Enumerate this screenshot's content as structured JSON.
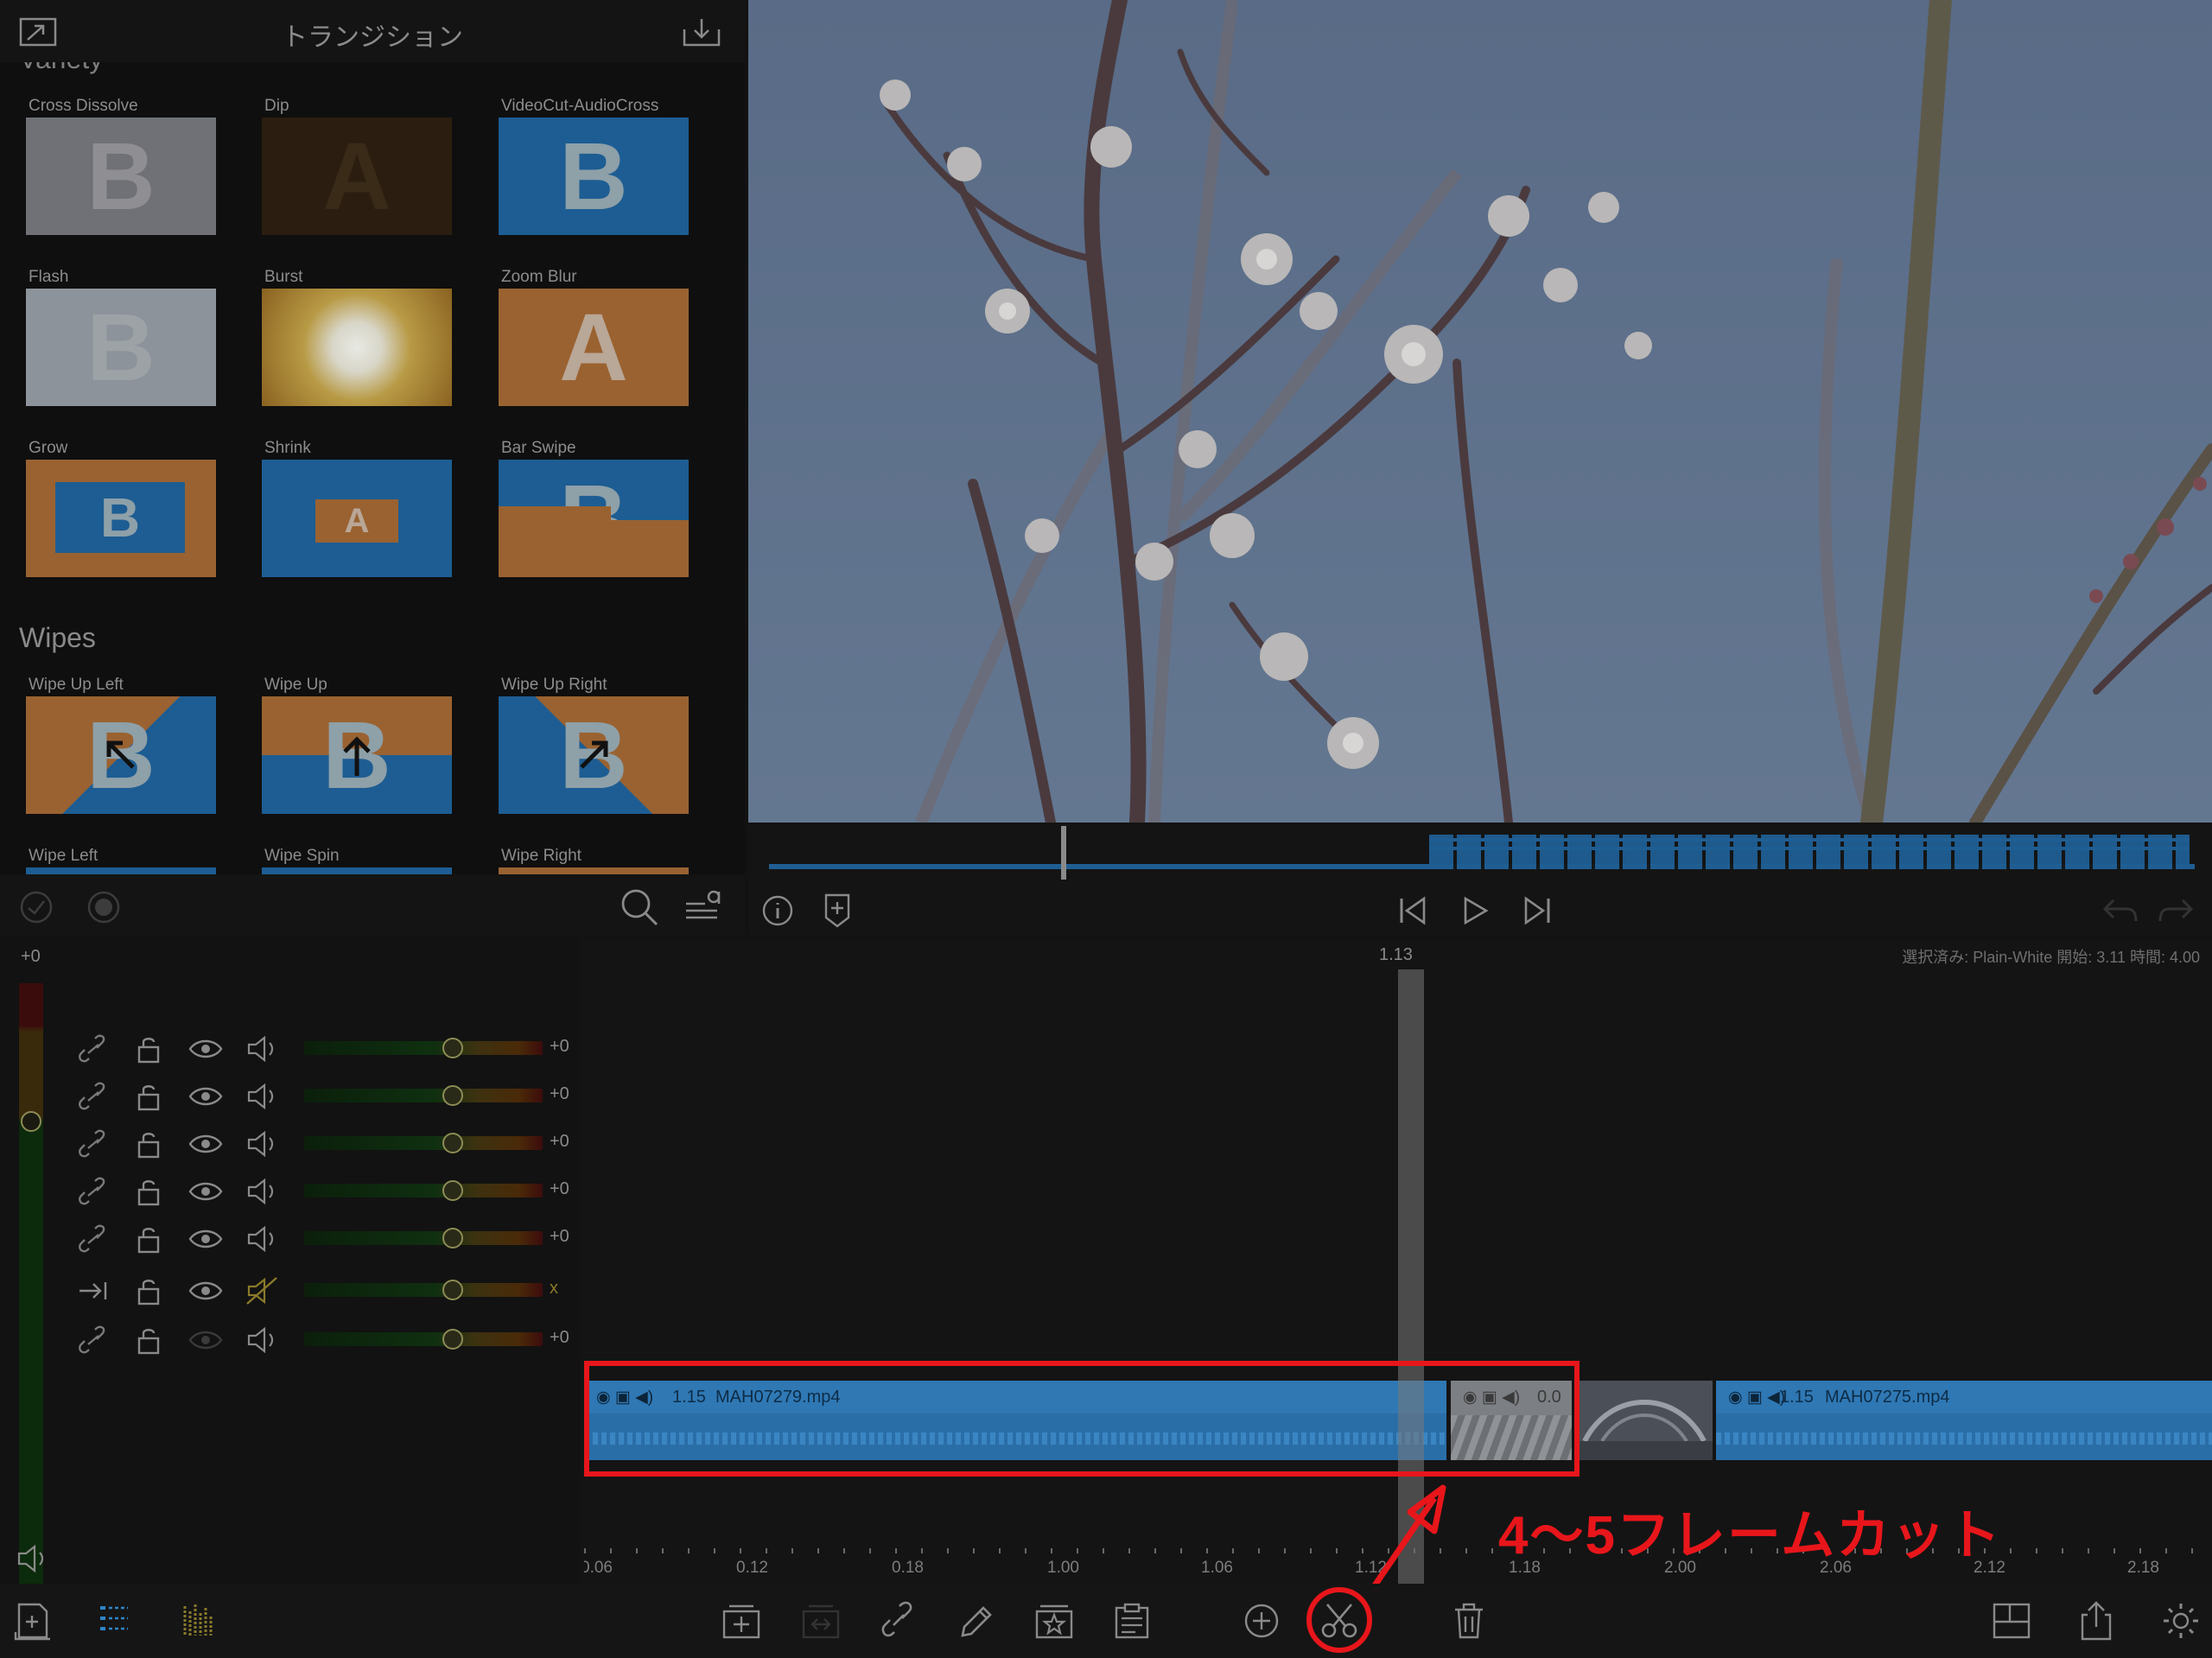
{
  "left_panel": {
    "title": "トランジション",
    "section_variety": "Variety",
    "section_wipes": "Wipes",
    "variety_tiles": [
      {
        "label": "Cross Dissolve",
        "letter": "B"
      },
      {
        "label": "Dip",
        "letter": "A"
      },
      {
        "label": "VideoCut-AudioCross",
        "letter": "B"
      },
      {
        "label": "Flash",
        "letter": "B"
      },
      {
        "label": "Burst",
        "letter": ""
      },
      {
        "label": "Zoom Blur",
        "letter": "A"
      },
      {
        "label": "Grow",
        "letter": "B"
      },
      {
        "label": "Shrink",
        "letter": "A"
      },
      {
        "label": "Bar Swipe",
        "letter": "B"
      }
    ],
    "wipe_tiles": [
      {
        "label": "Wipe Up Left",
        "letter": "B"
      },
      {
        "label": "Wipe Up",
        "letter": "B"
      },
      {
        "label": "Wipe Up Right",
        "letter": "B"
      },
      {
        "label": "Wipe Left",
        "letter": ""
      },
      {
        "label": "Wipe Spin",
        "letter": ""
      },
      {
        "label": "Wipe Right",
        "letter": ""
      }
    ]
  },
  "timeline": {
    "master_gain": "+0",
    "playhead_time": "1.13",
    "selection_info": "選択済み: Plain-White 開始: 3.11 時間: 4.00",
    "tracks": [
      {
        "gain": "+0"
      },
      {
        "gain": "+0"
      },
      {
        "gain": "+0"
      },
      {
        "gain": "+0"
      },
      {
        "gain": "+0"
      },
      {
        "gain": "x"
      },
      {
        "gain": "+0"
      }
    ],
    "ruler": [
      "0.06",
      "0.12",
      "0.18",
      "1.00",
      "1.06",
      "1.12",
      "1.18",
      "2.00",
      "2.06",
      "2.12",
      "2.18"
    ],
    "clips": [
      {
        "duration": "1.15",
        "name": "MAH07279.mp4"
      },
      {
        "duration": "0.0",
        "name": ""
      },
      {
        "duration": "1.15",
        "name": "MAH07275.mp4"
      }
    ]
  },
  "annotation": {
    "text": "4〜5フレームカット"
  },
  "colors": {
    "accent_blue": "#2e86c9",
    "annotation_red": "#e8161b",
    "sky": "#5a6c85"
  }
}
